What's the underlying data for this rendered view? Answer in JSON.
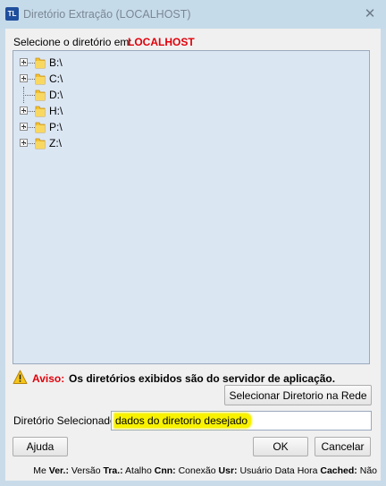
{
  "window": {
    "title": "Diretório Extração (LOCALHOST)",
    "app_icon_text": "TL",
    "close_glyph": "✕"
  },
  "header": {
    "select_label": "Selecione o diretório em:",
    "host": "LOCALHOST"
  },
  "tree": {
    "items": [
      {
        "label": "B:\\",
        "expandable": true
      },
      {
        "label": "C:\\",
        "expandable": true
      },
      {
        "label": "D:\\",
        "expandable": false
      },
      {
        "label": "H:\\",
        "expandable": true
      },
      {
        "label": "P:\\",
        "expandable": true
      },
      {
        "label": "Z:\\",
        "expandable": true
      }
    ]
  },
  "notice": {
    "label": "Aviso:",
    "text": "Os diretórios exibidos são do servidor de aplicação."
  },
  "buttons": {
    "network": "Selecionar Diretorio na Rede",
    "help": "Ajuda",
    "ok": "OK",
    "cancel": "Cancelar"
  },
  "selection": {
    "label": "Diretório Selecionado:",
    "value": "dados do diretorio desejado"
  },
  "statusbar": {
    "prefix": "Me",
    "ver_label": "Ver.:",
    "ver_value": "Versão",
    "tra_label": "Tra.:",
    "tra_value": "Atalho",
    "cnn_label": "Cnn:",
    "cnn_value": "Conexão",
    "usr_label": "Usr:",
    "usr_value": "Usuário",
    "date_value": "Data",
    "time_value": "Hora",
    "cached_label": "Cached:",
    "cached_value": "Não"
  },
  "colors": {
    "accent_red": "#e0000a",
    "highlight_yellow": "#f8f200",
    "folder_yellow": "#f2c230"
  },
  "icons": {
    "warning": "warning-icon",
    "folder": "folder-icon",
    "expand": "plus-expander-icon"
  }
}
